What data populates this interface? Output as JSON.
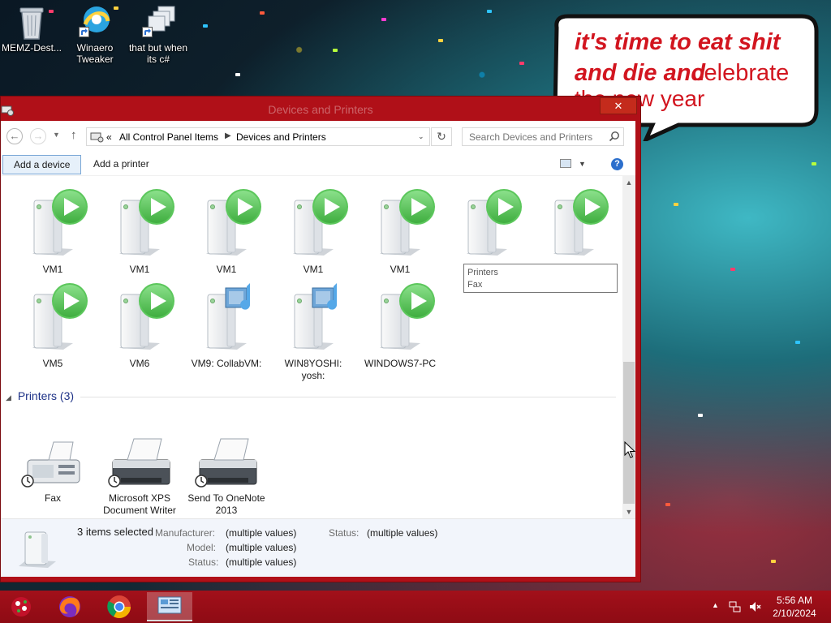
{
  "desktop": {
    "icons": [
      {
        "label": "MEMZ-Dest...",
        "icon": "recycle-bin-icon"
      },
      {
        "label": "Winaero Tweaker",
        "icon": "winaero-icon"
      },
      {
        "label": "that but when its c#",
        "icon": "stack-windows-icon"
      }
    ],
    "bubble": {
      "line1": "it's time to eat shit",
      "line2a": "and die and",
      "line2b": "celebrate",
      "line3": "the new year"
    }
  },
  "window": {
    "title": "Devices and Printers",
    "close_label": "✕",
    "address": {
      "crumbs": [
        "All Control Panel Items",
        "Devices and Printers"
      ],
      "prefix": "«"
    },
    "search_placeholder": "Search Devices and Printers",
    "commands": {
      "add_device": "Add a device",
      "add_printer": "Add a printer"
    },
    "devices_row1": [
      "VM1",
      "VM1",
      "VM1",
      "VM1",
      "VM1"
    ],
    "devices_row2": [
      "VM5",
      "VM6",
      "VM9: CollabVM:",
      "WIN8YOSHI: yosh:",
      "WINDOWS7-PC"
    ],
    "tooltip": {
      "line1": "Printers",
      "line2": "Fax"
    },
    "printers_group": "Printers (3)",
    "printers": [
      "Fax",
      "Microsoft XPS Document Writer",
      "Send To OneNote 2013"
    ],
    "details": {
      "selected": "3 items selected",
      "manufacturer_key": "Manufacturer:",
      "manufacturer_val": "(multiple values)",
      "model_key": "Model:",
      "model_val": "(multiple values)",
      "status_key": "Status:",
      "status_val": "(multiple values)",
      "status2_key": "Status:",
      "status2_val": "(multiple values)"
    }
  },
  "taskbar": {
    "time": "5:56 AM",
    "date": "2/10/2024",
    "apps": [
      "start-icon",
      "firefox-icon",
      "chrome-icon",
      "control-panel-icon"
    ]
  },
  "colors": {
    "window_frame": "#b01018",
    "accent_blue": "#1e3287",
    "play_green": "#5cc75c"
  }
}
